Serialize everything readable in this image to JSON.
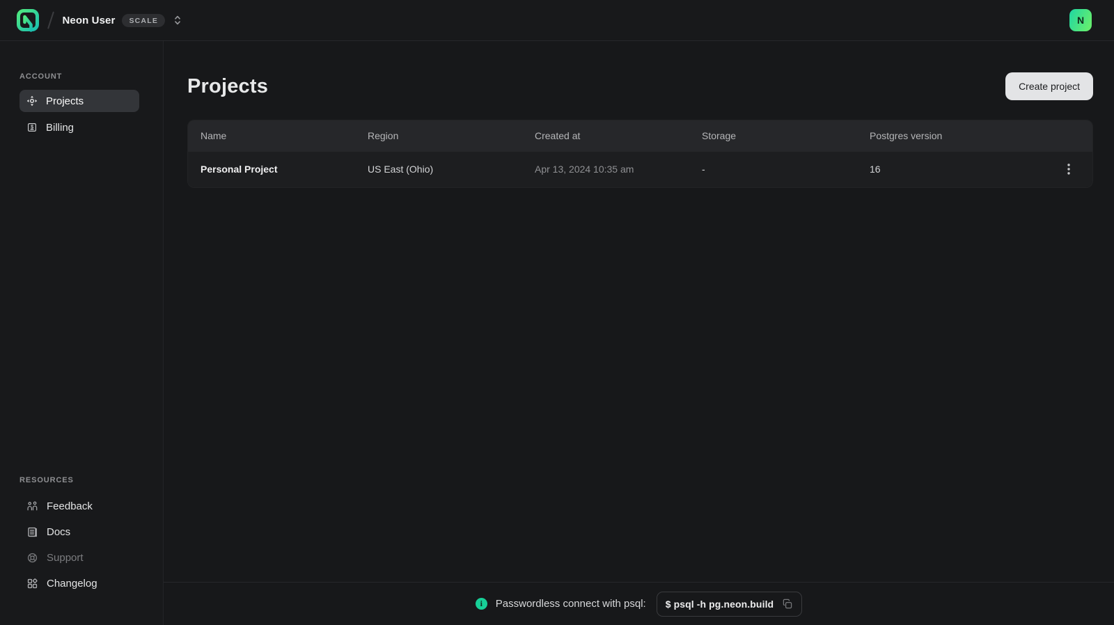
{
  "topbar": {
    "workspace_name": "Neon User",
    "plan_badge": "SCALE",
    "avatar_initial": "N"
  },
  "sidebar": {
    "account": {
      "label": "Account",
      "items": [
        {
          "label": "Projects",
          "icon": "projects-icon",
          "selected": true
        },
        {
          "label": "Billing",
          "icon": "billing-icon",
          "selected": false
        }
      ]
    },
    "resources": {
      "label": "Resources",
      "items": [
        {
          "label": "Feedback",
          "icon": "feedback-icon"
        },
        {
          "label": "Docs",
          "icon": "docs-icon"
        },
        {
          "label": "Support",
          "icon": "support-icon",
          "dimmed": true
        },
        {
          "label": "Changelog",
          "icon": "changelog-icon"
        }
      ]
    }
  },
  "main": {
    "page_title": "Projects",
    "create_button_label": "Create project",
    "table": {
      "columns": [
        "Name",
        "Region",
        "Created at",
        "Storage",
        "Postgres version"
      ],
      "rows": [
        {
          "name": "Personal Project",
          "region": "US East (Ohio)",
          "created_at": "Apr 13, 2024 10:35 am",
          "storage": "-",
          "postgres_version": "16"
        }
      ]
    }
  },
  "footer": {
    "message": "Passwordless connect with psql:",
    "command": "$ psql -h pg.neon.build"
  },
  "icons": {
    "neon-logo": "rounded-square-n-mark",
    "workspace-switcher-icon": "chevron-up-down",
    "projects-icon": "compass-move",
    "billing-icon": "dollar-receipt",
    "feedback-icon": "two-users",
    "docs-icon": "document-lines",
    "support-icon": "lifebuoy",
    "changelog-icon": "grid-squares-diamond",
    "row-menu-icon": "kebab-vertical-dots",
    "info-icon": "info-circle",
    "copy-icon": "copy-squares"
  },
  "colors": {
    "accent_green": "#00e599",
    "info_green": "#17cf97",
    "background": "#18191b",
    "table_header_bg": "#26272a",
    "table_row_bg": "#1d1e20",
    "selected_item_bg": "#333539",
    "button_bg": "#e3e4e6"
  }
}
